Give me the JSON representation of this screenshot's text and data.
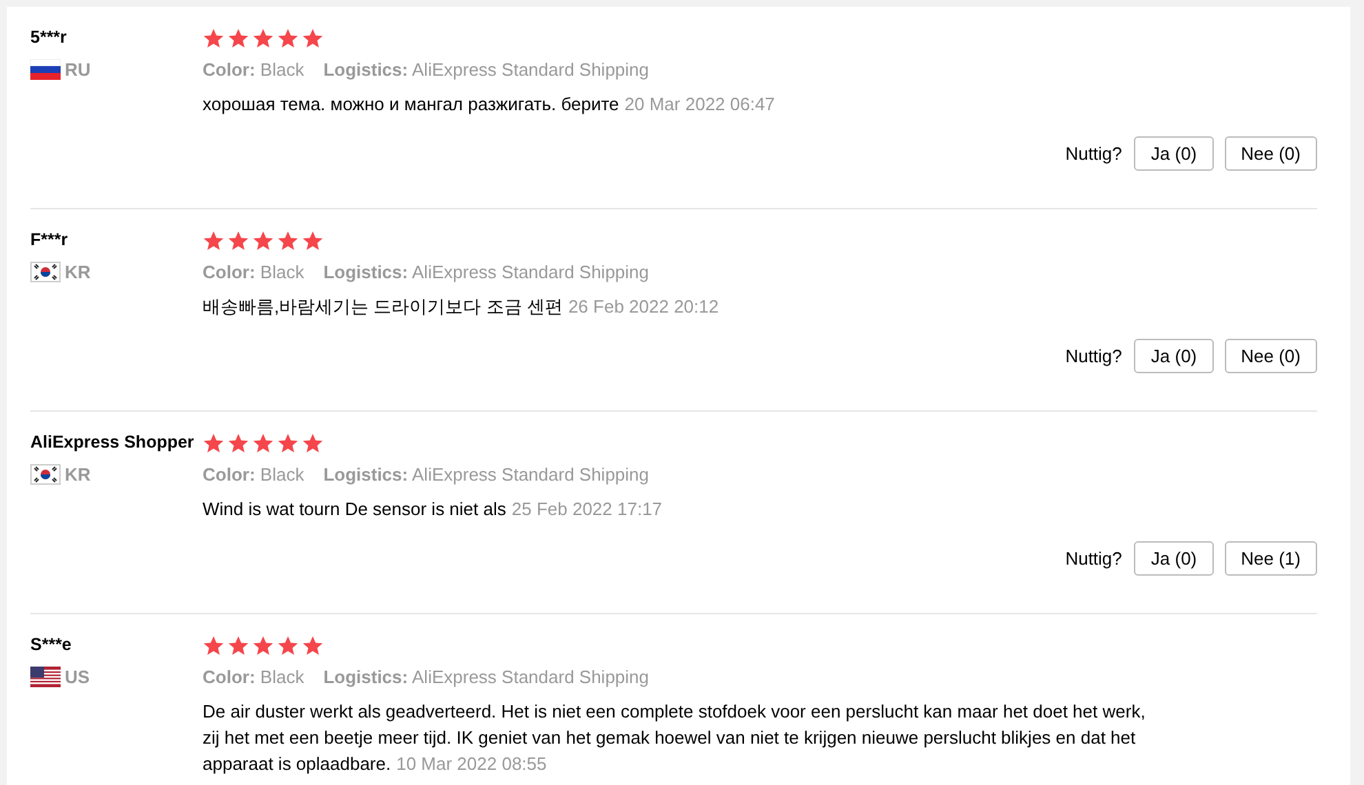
{
  "reviews": [
    {
      "name": "5***r",
      "kind": "ru",
      "country": "RU",
      "stars": 5,
      "color_label": "Color:",
      "color_value": "Black",
      "logistics_label": "Logistics:",
      "logistics": "AliExpress Standard Shipping",
      "text": "хорошая тема. можно и мангал разжигать. берите",
      "date": "20 Mar 2022 06:47",
      "helpful_label": "Nuttig?",
      "yes": "Ja (0)",
      "no": "Nee (0)"
    },
    {
      "name": "F***r",
      "kind": "kr",
      "country": "KR",
      "stars": 5,
      "color_label": "Color:",
      "color_value": "Black",
      "logistics_label": "Logistics:",
      "logistics": "AliExpress Standard Shipping",
      "text": "배송빠름,바람세기는 드라이기보다 조금 센편",
      "date": "26 Feb 2022 20:12",
      "helpful_label": "Nuttig?",
      "yes": "Ja (0)",
      "no": "Nee (0)"
    },
    {
      "name": "AliExpress Shopper",
      "kind": "kr",
      "country": "KR",
      "stars": 5,
      "color_label": "Color:",
      "color_value": "Black",
      "logistics_label": "Logistics:",
      "logistics": "AliExpress Standard Shipping",
      "text": "Wind is wat tourn De sensor is niet als",
      "date": "25 Feb 2022 17:17",
      "helpful_label": "Nuttig?",
      "yes": "Ja (0)",
      "no": "Nee (1)"
    },
    {
      "name": "S***e",
      "kind": "us",
      "country": "US",
      "stars": 5,
      "color_label": "Color:",
      "color_value": "Black",
      "logistics_label": "Logistics:",
      "logistics": "AliExpress Standard Shipping",
      "text": "De air duster werkt als geadverteerd. Het is niet een complete stofdoek voor een perslucht kan maar het doet het werk, zij het met een beetje meer tijd. IK geniet van het gemak hoewel van niet te krijgen nieuwe perslucht blikjes en dat het apparaat is oplaadbare.",
      "date": "10 Mar 2022 08:55"
    }
  ]
}
